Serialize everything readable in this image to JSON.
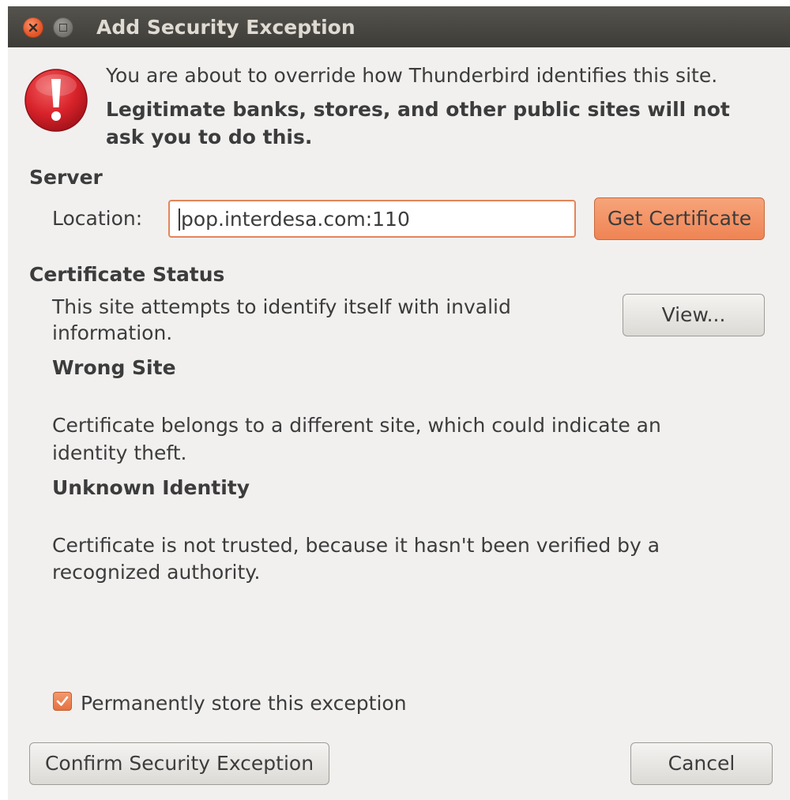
{
  "window": {
    "title": "Add Security Exception"
  },
  "intro": {
    "line1": "You are about to override how Thunderbird identifies this site.",
    "line2": "Legitimate banks, stores, and other public sites will not",
    "line3": "ask you to do this."
  },
  "server": {
    "heading": "Server",
    "location_label": "Location:",
    "location_value": "pop.interdesa.com:110",
    "get_certificate_label": "Get Certificate"
  },
  "certificate_status": {
    "heading": "Certificate Status",
    "desc_line1": "This site attempts to identify itself with invalid",
    "desc_line2": "information.",
    "view_label": "View...",
    "wrong_site_heading": "Wrong Site",
    "wrong_site_line1": "Certificate belongs to a different site, which could indicate an",
    "wrong_site_line2": "identity theft.",
    "unknown_identity_heading": "Unknown Identity",
    "unknown_identity_line1": "Certificate is not trusted, because it hasn't been verified by a",
    "unknown_identity_line2": "recognized authority."
  },
  "options": {
    "permanent_label": "Permanently store this exception",
    "permanent_checked": true
  },
  "actions": {
    "confirm_label": "Confirm Security Exception",
    "cancel_label": "Cancel"
  },
  "icons": {
    "close": "close-icon",
    "maximize": "maximize-icon",
    "warning": "warning-icon",
    "check": "check-icon"
  },
  "colors": {
    "titlebar": "#3d3c38",
    "accent": "#ef8454",
    "warning": "#d9232b",
    "window_bg": "#f1f0ef"
  }
}
